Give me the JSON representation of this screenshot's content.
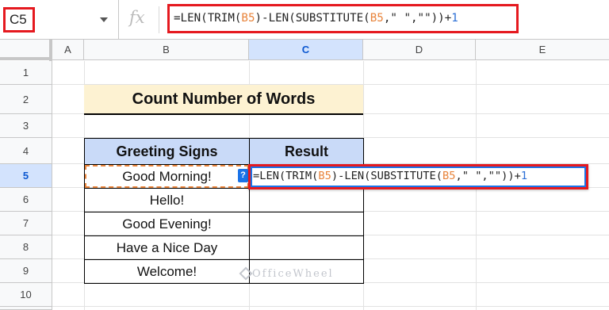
{
  "formula_bar": {
    "name_box": "C5",
    "fx_label": "fx",
    "formula_parts": {
      "p1": "=LEN(TRIM(",
      "ref1": "B5",
      "p2": ")-LEN(SUBSTITUTE(",
      "ref2": "B5",
      "p3": ",\" \",\"\"))+",
      "num": "1"
    }
  },
  "columns": [
    "A",
    "B",
    "C",
    "D",
    "E"
  ],
  "rows": [
    "1",
    "2",
    "3",
    "4",
    "5",
    "6",
    "7",
    "8",
    "9",
    "10"
  ],
  "active": {
    "cell": "C5",
    "column": "C",
    "row": "5"
  },
  "sheet": {
    "title": "Count Number of Words",
    "table_headers": {
      "col1": "Greeting Signs",
      "col2": "Result"
    },
    "rows": [
      {
        "sign": "Good Morning!",
        "result": ""
      },
      {
        "sign": "Hello!",
        "result": ""
      },
      {
        "sign": "Good Evening!",
        "result": ""
      },
      {
        "sign": "Have a Nice Day",
        "result": ""
      },
      {
        "sign": "Welcome!",
        "result": ""
      }
    ]
  },
  "help_chip": "?",
  "watermark": "OfficeWheel",
  "colors": {
    "highlight_red": "#e5191f",
    "title_fill": "#fdf2d2",
    "header_fill": "#c9daf8",
    "cell_ref_orange": "#e8833a",
    "selection_blue": "#1a73e8"
  }
}
